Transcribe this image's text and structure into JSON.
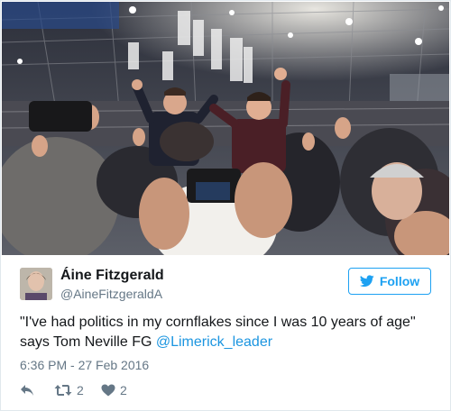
{
  "author": {
    "display_name": "Áine Fitzgerald",
    "handle": "@AineFitzgeraldA"
  },
  "follow_button": {
    "label": "Follow",
    "icon": "bird-icon"
  },
  "tweet": {
    "text_part1": "\"I've had politics in my cornflakes since I was 10 years of age\" says Tom Neville FG ",
    "mention": "@Limerick_leader",
    "timestamp": "6:36 PM - 27 Feb 2016"
  },
  "actions": {
    "reply_icon": "reply-icon",
    "retweet_icon": "retweet-icon",
    "retweet_count": "2",
    "like_icon": "heart-icon",
    "like_count": "2"
  },
  "colors": {
    "accent": "#1da1f2",
    "link": "#1b95e0",
    "text": "#14171a",
    "muted": "#657786",
    "border": "#e1e8ed"
  }
}
